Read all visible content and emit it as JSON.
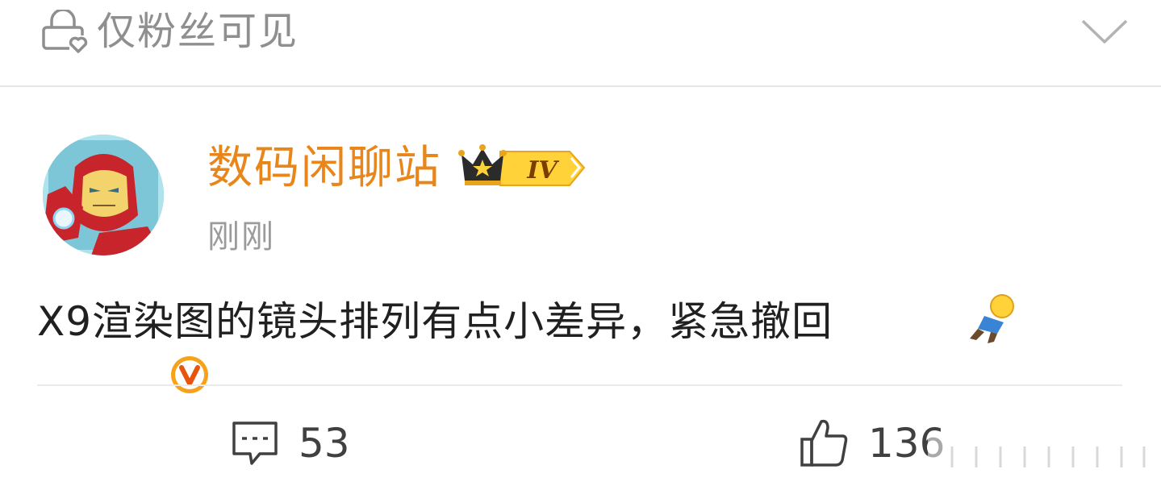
{
  "visibility": {
    "label": "仅粉丝可见",
    "lock_icon": "fans-lock-icon",
    "collapse_icon": "chevron-down-icon"
  },
  "author": {
    "name": "数码闲聊站",
    "time": "刚刚",
    "vip_level_text": "IV",
    "verified_badge_text": "V",
    "name_color": "#e8861b"
  },
  "post": {
    "text": "X9渲染图的镜头排列有点小差异，紧急撤回",
    "emoji_icon": "fleeing-person-emoji"
  },
  "actions": {
    "comment_count": "53",
    "like_count": "136",
    "comment_icon": "comment-icon",
    "like_icon": "thumbs-up-icon"
  },
  "colors": {
    "divider": "#ebebeb",
    "muted_text": "#8f8f8f",
    "body_text": "#202020"
  }
}
